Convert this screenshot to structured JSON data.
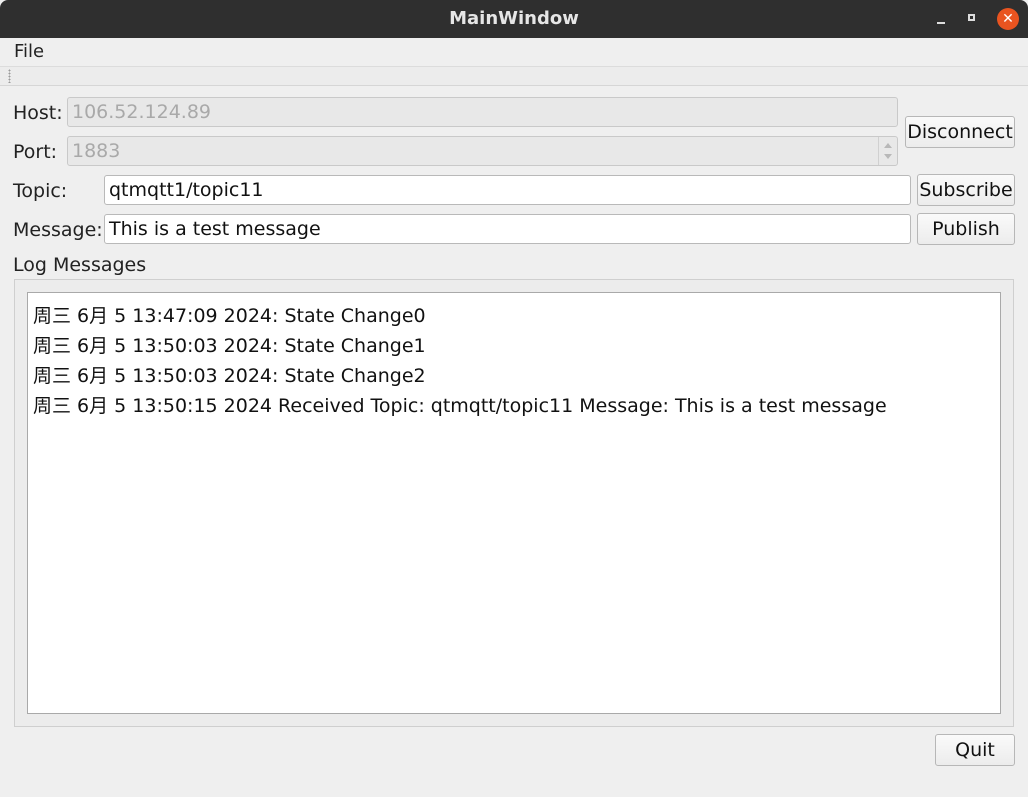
{
  "window": {
    "title": "MainWindow"
  },
  "menubar": {
    "file": "File"
  },
  "connection": {
    "host_label": "Host:",
    "host_value": "106.52.124.89",
    "port_label": "Port:",
    "port_value": "1883",
    "disconnect_label": "Disconnect"
  },
  "topic": {
    "label": "Topic:",
    "value": "qtmqtt1/topic11",
    "subscribe_label": "Subscribe"
  },
  "message": {
    "label": "Message:",
    "value": "This is a test message",
    "publish_label": "Publish"
  },
  "log": {
    "title": "Log Messages",
    "lines": [
      "周三 6月 5 13:47:09 2024: State Change0",
      "周三 6月 5 13:50:03 2024: State Change1",
      "周三 6月 5 13:50:03 2024: State Change2",
      "周三 6月 5 13:50:15 2024 Received Topic: qtmqtt/topic11 Message: This is a test message"
    ]
  },
  "footer": {
    "quit_label": "Quit"
  },
  "colors": {
    "titlebar": "#2f2f2f",
    "close_button": "#e95420",
    "window_bg": "#efefef"
  },
  "icons": {
    "minimize": "minimize-icon",
    "maximize": "maximize-icon",
    "close": "close-icon"
  }
}
